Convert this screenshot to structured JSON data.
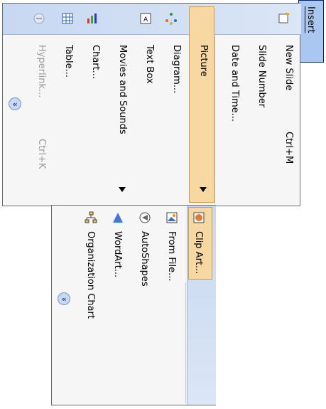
{
  "insert_menu_label": "Insert",
  "main_menu": {
    "items": [
      {
        "label": "New Slide",
        "shortcut": "Ctrl+M"
      },
      {
        "label": "Slide Number"
      },
      {
        "label": "Date and Time..."
      },
      {
        "label": "Picture"
      },
      {
        "label": "Diagram..."
      },
      {
        "label": "Text Box"
      },
      {
        "label": "Movies and Sounds"
      },
      {
        "label": "Chart..."
      },
      {
        "label": "Table..."
      },
      {
        "label": "Hyperlink...",
        "shortcut": "Ctrl+K",
        "disabled": true
      }
    ]
  },
  "picture_submenu": {
    "items": [
      {
        "label": "Clip Art..."
      },
      {
        "label": "From File..."
      },
      {
        "label": "AutoShapes"
      },
      {
        "label": "WordArt..."
      },
      {
        "label": "Organization Chart"
      }
    ]
  },
  "icons": {
    "new_slide": "new-slide-icon",
    "diagram": "diagram-icon",
    "text_box": "text-box-icon",
    "chart": "chart-icon",
    "table": "table-icon",
    "hyperlink": "hyperlink-icon",
    "expand": "double-chevron-icon",
    "clip_art": "clip-art-icon",
    "from_file": "picture-from-file-icon",
    "autoshapes": "autoshapes-icon",
    "wordart": "wordart-icon",
    "org_chart": "organization-chart-icon"
  },
  "colors": {
    "highlight": "#f7d7a2",
    "iconbar": "#c7d8f1",
    "menu_bg": "#f6f6f6",
    "disabled": "#9a9a9a"
  }
}
